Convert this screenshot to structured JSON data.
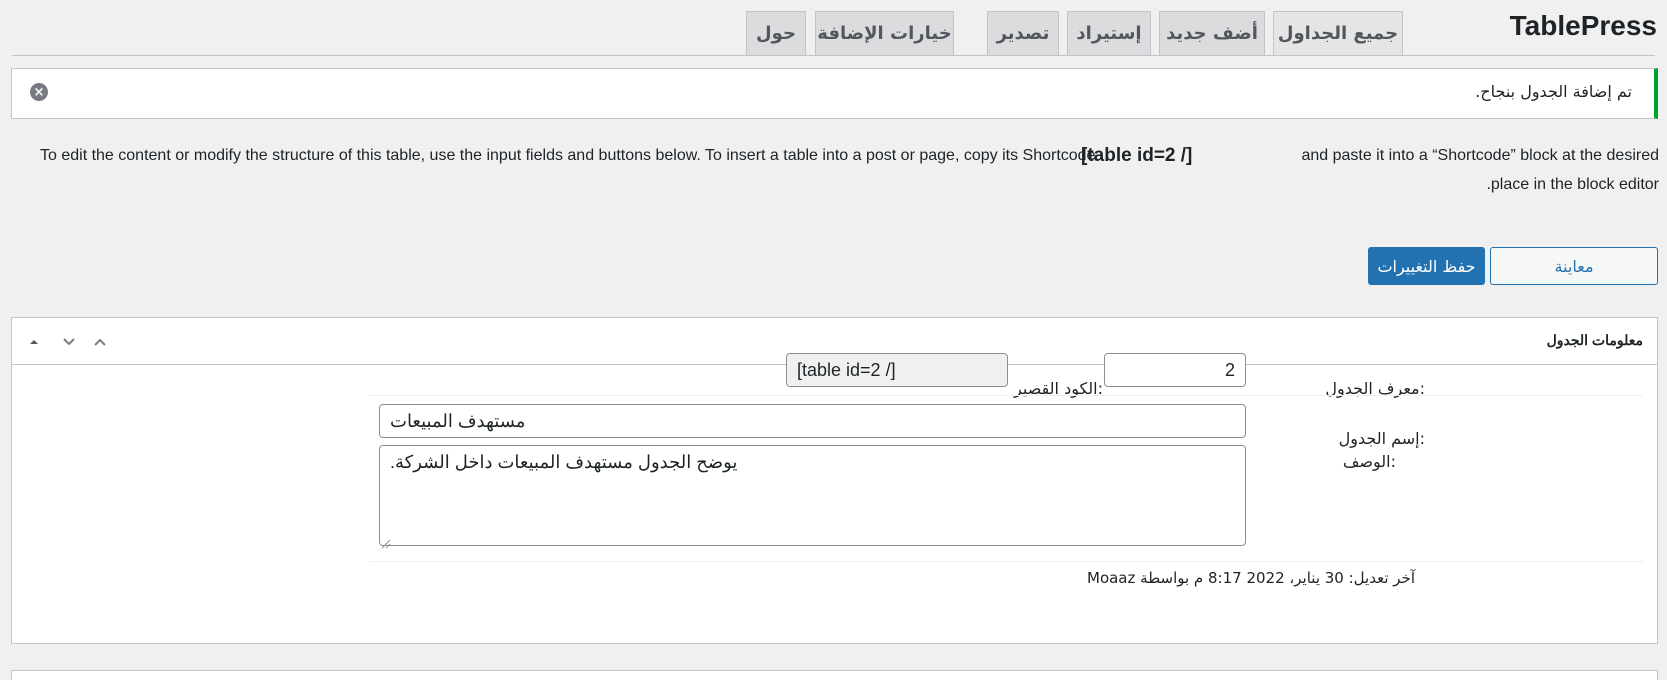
{
  "app": {
    "title": "TablePress"
  },
  "tabs": {
    "all_tables": "جميع الجداول",
    "add_new": "أضف جديد",
    "import": "إستيراد",
    "export": "تصدير",
    "plugin_options": "خيارات الإضافة",
    "about": "حول"
  },
  "notice": {
    "text": "تم إضافة الجدول بنجاح.",
    "close_icon": "×"
  },
  "description": {
    "line1_part1": "To edit the content or modify the structure of this table, use the input fields and buttons below. To insert a table into a post or page, copy its Shortcode",
    "shortcode": "[table id=2 /]",
    "line1_part2": "and paste it into a “Shortcode” block at the desired",
    "line2": ".place in the block editor"
  },
  "actions": {
    "preview": "معاينة",
    "save": "حفظ التغييرات"
  },
  "table_info": {
    "title": "معلومات الجدول",
    "id_label": "معرف الجدول:",
    "id_value": "2",
    "shortcode_label": "الكود القصير:",
    "shortcode_value": "[table id=2 /]",
    "name_label": "إسم الجدول:",
    "name_value": "مستهدف المبيعات",
    "desc_label": "الوصف:",
    "desc_value": "يوضح الجدول مستهدف المبيعات داخل الشركة.",
    "last_modified": "آخر تعديل: 30 يناير، 2022 8:17 م بواسطة Moaaz"
  },
  "colors": {
    "accent": "#2271b1",
    "success": "#00a32a"
  }
}
